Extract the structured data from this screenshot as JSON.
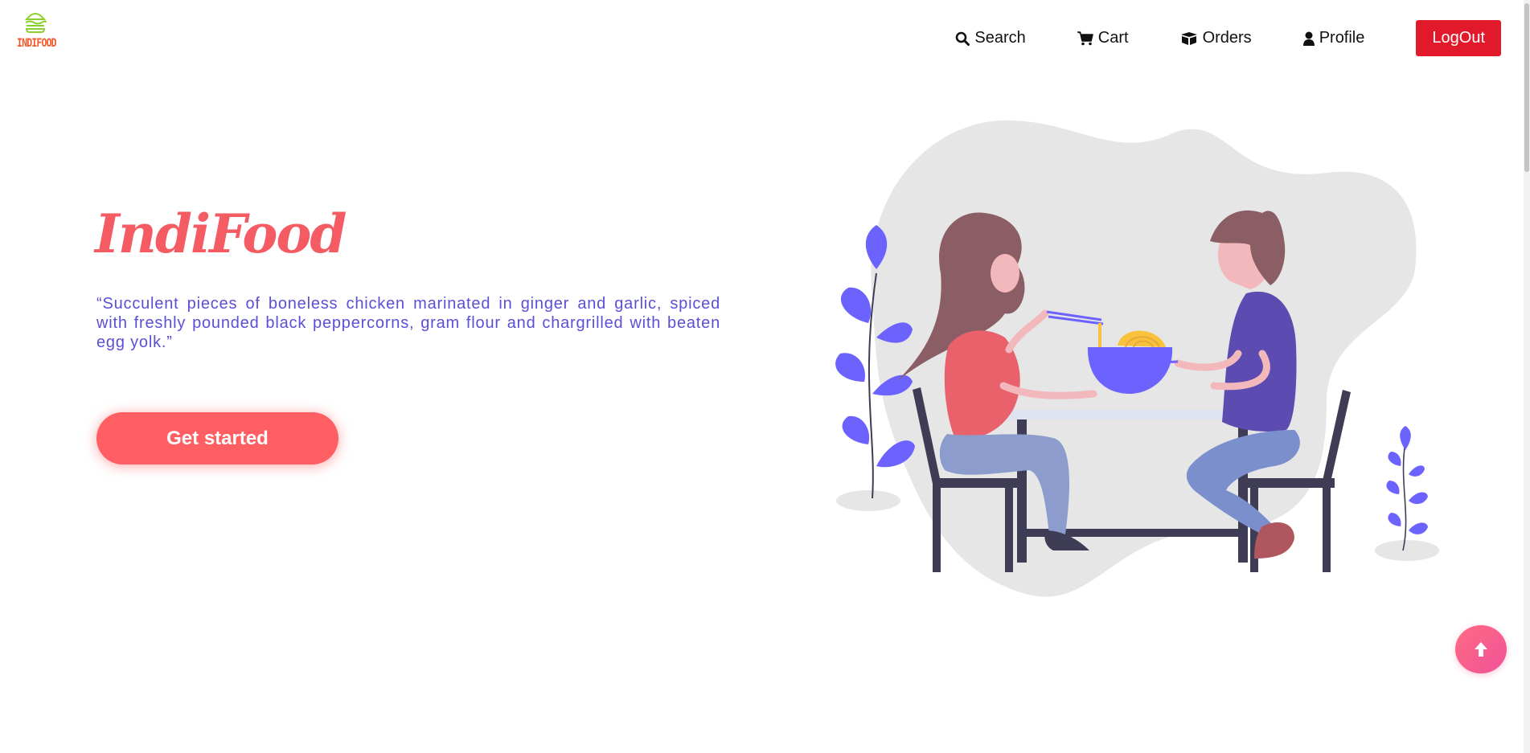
{
  "logo": {
    "text": "INDIFOOD",
    "icon": "burger-icon"
  },
  "nav": {
    "search": {
      "label": "Search",
      "icon": "search-icon"
    },
    "cart": {
      "label": "Cart",
      "icon": "cart-icon"
    },
    "orders": {
      "label": "Orders",
      "icon": "box-icon"
    },
    "profile": {
      "label": "Profile",
      "icon": "user-icon"
    },
    "logout": {
      "label": "LogOut"
    }
  },
  "hero": {
    "title": "IndiFood",
    "quote": "“Succulent pieces of boneless chicken marinated in ginger and garlic, spiced with freshly pounded black peppercorns, gram flour and chargrilled with beaten egg yolk.”",
    "cta_label": "Get started",
    "illustration": "couple-eating-noodles-illustration"
  },
  "scroll_top": {
    "icon": "arrow-up-icon"
  },
  "colors": {
    "brand": "#f45b63",
    "quote": "#5b4fd8",
    "logout": "#e2192b",
    "logo_green": "#8bd12e",
    "logo_orange": "#f0582a"
  }
}
